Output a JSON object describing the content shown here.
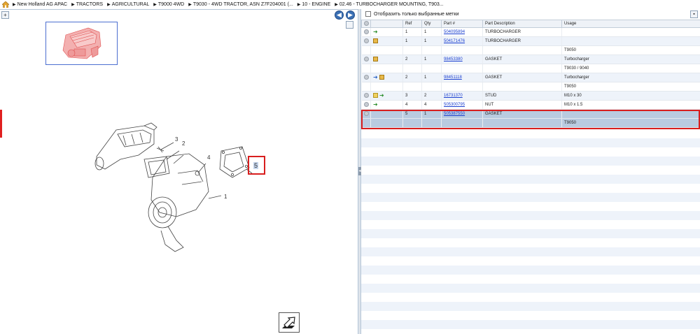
{
  "breadcrumb": {
    "items": [
      "New Holland AG APAC",
      "TRACTORS",
      "AGRICULTURAL",
      "T9000 4WD",
      "T9030 - 4WD TRACTOR, ASN Z7F204001 (...",
      "10 - ENGINE",
      "02.46 - TURBOCHARGER MOUNTING, T903..."
    ]
  },
  "left": {
    "toolbar_zoom": "+",
    "callouts": [
      "1",
      "2",
      "3",
      "4",
      "5"
    ],
    "selected_callout": "5"
  },
  "right": {
    "filter_label": "Отобразить только выбранные метки",
    "columns": [
      "",
      "",
      "Ref",
      "Qty",
      "Part #",
      "Part Description",
      "Usage"
    ],
    "rows": [
      {
        "ref": "1",
        "qty": "1",
        "part": "504095894",
        "desc": "TURBOCHARGER",
        "usage": "",
        "icons": [
          "circle-icon",
          "green-arrow-icon"
        ]
      },
      {
        "ref": "1",
        "qty": "1",
        "part": "504171476",
        "desc": "TURBOCHARGER",
        "usage": "",
        "icons": [
          "circle-icon",
          "package-icon"
        ]
      },
      {
        "ref": "",
        "qty": "",
        "part": "",
        "desc": "",
        "usage": "T9050",
        "icons": []
      },
      {
        "ref": "2",
        "qty": "1",
        "part": "98453380",
        "desc": "GASKET",
        "usage": "Turbocharger",
        "icons": [
          "circle-icon",
          "package-icon"
        ]
      },
      {
        "ref": "",
        "qty": "",
        "part": "",
        "desc": "",
        "usage": "T9030 / 9040",
        "icons": []
      },
      {
        "ref": "2",
        "qty": "1",
        "part": "98451118",
        "desc": "GASKET",
        "usage": "Turbocharger",
        "icons": [
          "circle-icon",
          "blue-arrow-icon",
          "package-icon"
        ]
      },
      {
        "ref": "",
        "qty": "",
        "part": "",
        "desc": "",
        "usage": "T9050",
        "icons": []
      },
      {
        "ref": "3",
        "qty": "2",
        "part": "16731370",
        "desc": "STUD",
        "usage": "M10 x 30",
        "icons": [
          "circle-icon",
          "note-icon",
          "green-arrow-icon"
        ]
      },
      {
        "ref": "4",
        "qty": "4",
        "part": "505300795",
        "desc": "NUT",
        "usage": "M10 x 1.5",
        "icons": [
          "circle-icon",
          "green-arrow-icon"
        ]
      },
      {
        "ref": "5",
        "qty": "1",
        "part": "505387550",
        "desc": "GASKET",
        "usage": "",
        "icons": [
          "circle-icon"
        ],
        "selected": true
      },
      {
        "ref": "",
        "qty": "",
        "part": "",
        "desc": "",
        "usage": "T9050",
        "icons": [],
        "selected": true
      }
    ]
  },
  "colors": {
    "accent": "#3a6fb4",
    "highlight": "#d81e1e",
    "selected_row": "#b9cbe0",
    "link": "#1a3fd0"
  }
}
